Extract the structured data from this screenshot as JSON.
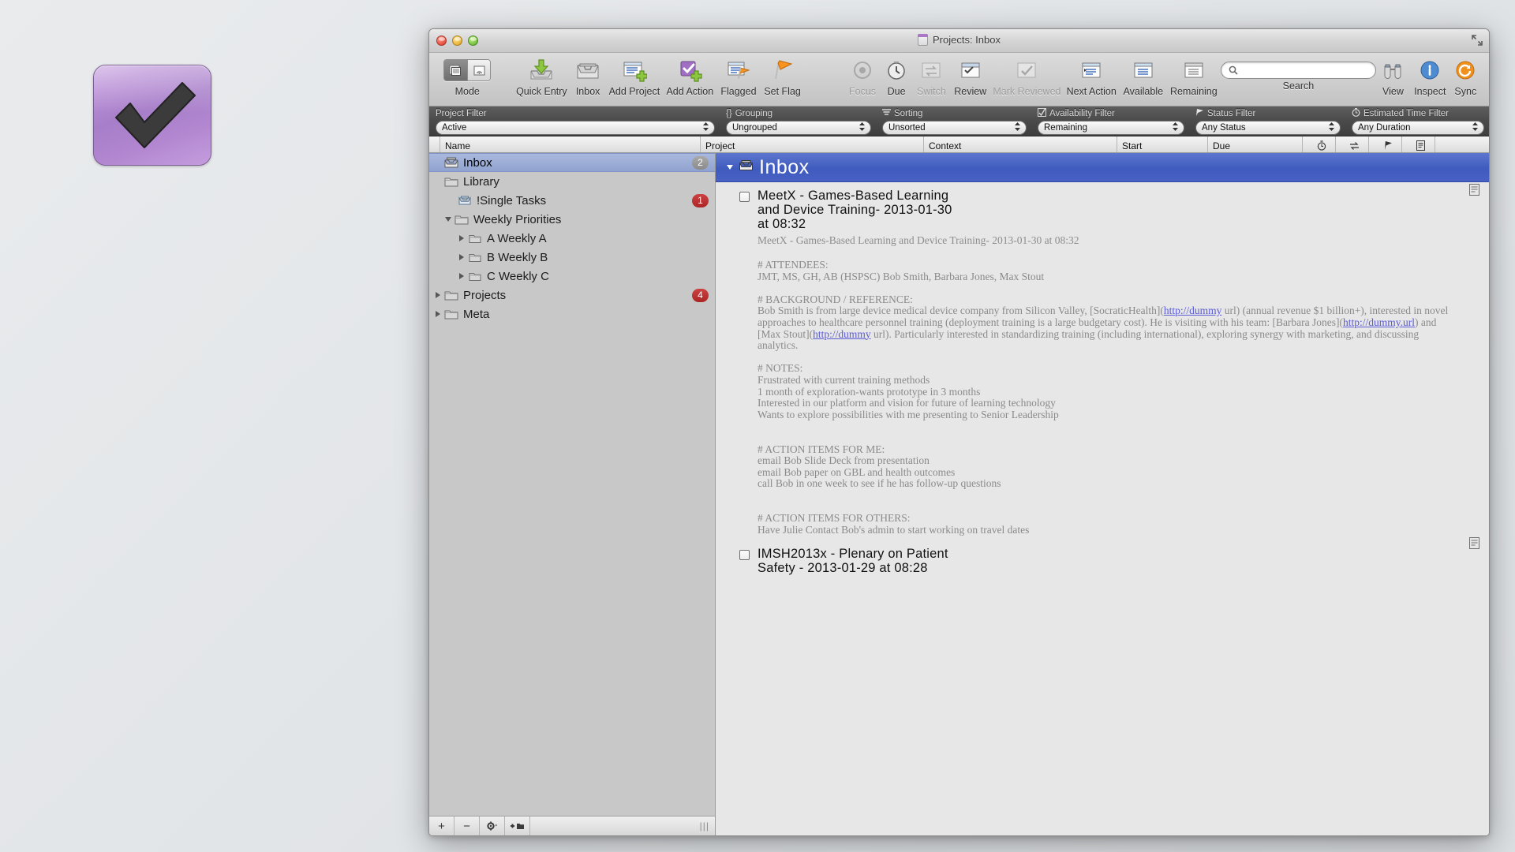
{
  "desktop": {
    "icon_name": "omnifocus-app-icon"
  },
  "window": {
    "title": "Projects: Inbox",
    "traffic_lights": [
      "close",
      "minimize",
      "zoom"
    ],
    "fullscreen_label": "full-screen"
  },
  "toolbar": {
    "items": [
      {
        "name": "mode",
        "label": "Mode",
        "icon": "segmented-mode-control",
        "disabled": false
      },
      {
        "name": "quick-entry",
        "label": "Quick Entry",
        "icon": "inbox-down-arrow-icon",
        "disabled": false
      },
      {
        "name": "inbox",
        "label": "Inbox",
        "icon": "inbox-tray-icon",
        "disabled": false
      },
      {
        "name": "add-project",
        "label": "Add Project",
        "icon": "list-plus-icon",
        "disabled": false
      },
      {
        "name": "add-action",
        "label": "Add Action",
        "icon": "purple-check-plus-icon",
        "disabled": false
      },
      {
        "name": "flagged",
        "label": "Flagged",
        "icon": "list-flag-icon",
        "disabled": false
      },
      {
        "name": "set-flag",
        "label": "Set Flag",
        "icon": "orange-flag-icon",
        "disabled": false
      },
      {
        "name": "focus",
        "label": "Focus",
        "icon": "focus-target-icon",
        "disabled": true
      },
      {
        "name": "due",
        "label": "Due",
        "icon": "clock-icon",
        "disabled": false
      },
      {
        "name": "switch",
        "label": "Switch",
        "icon": "switch-arrows-icon",
        "disabled": true
      },
      {
        "name": "review",
        "label": "Review",
        "icon": "review-calendar-icon",
        "disabled": false
      },
      {
        "name": "mark-reviewed",
        "label": "Mark Reviewed",
        "icon": "mark-reviewed-icon",
        "disabled": true
      },
      {
        "name": "next-action",
        "label": "Next Action",
        "icon": "next-action-icon",
        "disabled": false
      },
      {
        "name": "available",
        "label": "Available",
        "icon": "available-icon",
        "disabled": false
      },
      {
        "name": "remaining",
        "label": "Remaining",
        "icon": "remaining-icon",
        "disabled": false
      }
    ],
    "search": {
      "label": "Search",
      "placeholder": "",
      "value": ""
    },
    "right_items": [
      {
        "name": "view",
        "label": "View",
        "icon": "view-binoculars-icon"
      },
      {
        "name": "inspect",
        "label": "Inspect",
        "icon": "info-circle-icon"
      },
      {
        "name": "sync",
        "label": "Sync",
        "icon": "sync-refresh-icon"
      }
    ]
  },
  "filters": [
    {
      "name": "project-filter",
      "label": "Project Filter",
      "icon": "",
      "value": "Active"
    },
    {
      "name": "grouping",
      "label": "Grouping",
      "icon": "braces-icon",
      "value": "Ungrouped"
    },
    {
      "name": "sorting",
      "label": "Sorting",
      "icon": "sort-lines-icon",
      "value": "Unsorted"
    },
    {
      "name": "availability-filter",
      "label": "Availability Filter",
      "icon": "checkbox-icon",
      "value": "Remaining"
    },
    {
      "name": "status-filter",
      "label": "Status Filter",
      "icon": "flag-icon",
      "value": "Any Status"
    },
    {
      "name": "estimated-time-filter",
      "label": "Estimated Time Filter",
      "icon": "stopwatch-icon",
      "value": "Any Duration"
    }
  ],
  "columns": [
    {
      "name": "name",
      "label": "Name"
    },
    {
      "name": "project",
      "label": "Project"
    },
    {
      "name": "context",
      "label": "Context"
    },
    {
      "name": "start",
      "label": "Start"
    },
    {
      "name": "due",
      "label": "Due"
    }
  ],
  "column_icons": [
    {
      "name": "duration-column",
      "icon": "stopwatch-icon"
    },
    {
      "name": "repeat-column",
      "icon": "repeat-arrows-icon"
    },
    {
      "name": "flag-column",
      "icon": "flag-icon"
    },
    {
      "name": "note-column",
      "icon": "note-icon"
    }
  ],
  "sidebar": {
    "items": [
      {
        "name": "inbox",
        "label": "Inbox",
        "icon": "inbox-tray-icon",
        "indent": 0,
        "disclosure": "none",
        "badge": "2",
        "badge_color": "grey",
        "selected": true
      },
      {
        "name": "library",
        "label": "Library",
        "icon": "folder-icon",
        "indent": 0,
        "disclosure": "none",
        "badge": "",
        "badge_color": "",
        "selected": false
      },
      {
        "name": "single-tasks",
        "label": "!Single Tasks",
        "icon": "single-tasks-icon",
        "indent": 1,
        "disclosure": "none",
        "badge": "1",
        "badge_color": "red",
        "selected": false
      },
      {
        "name": "weekly-priorities",
        "label": "Weekly Priorities",
        "icon": "folder-icon",
        "indent": 1,
        "disclosure": "down",
        "badge": "",
        "badge_color": "",
        "selected": false
      },
      {
        "name": "a-weekly-a",
        "label": "A Weekly A",
        "icon": "folder-icon",
        "indent": 2,
        "disclosure": "right",
        "badge": "",
        "badge_color": "",
        "selected": false
      },
      {
        "name": "b-weekly-b",
        "label": "B Weekly B",
        "icon": "folder-icon",
        "indent": 2,
        "disclosure": "right",
        "badge": "",
        "badge_color": "",
        "selected": false
      },
      {
        "name": "c-weekly-c",
        "label": "C Weekly C",
        "icon": "folder-icon",
        "indent": 2,
        "disclosure": "right",
        "badge": "",
        "badge_color": "",
        "selected": false
      },
      {
        "name": "projects",
        "label": "Projects",
        "icon": "folder-icon",
        "indent": 1,
        "disclosure": "right",
        "badge": "4",
        "badge_color": "red",
        "selected": false
      },
      {
        "name": "meta",
        "label": "Meta",
        "icon": "folder-icon",
        "indent": 1,
        "disclosure": "right",
        "badge": "",
        "badge_color": "",
        "selected": false
      }
    ],
    "bottom_buttons": [
      {
        "name": "add-item-button",
        "label": "+",
        "icon": "plus-icon"
      },
      {
        "name": "remove-item-button",
        "label": "−",
        "icon": "minus-icon"
      },
      {
        "name": "action-menu-button",
        "label": "",
        "icon": "gear-icon"
      },
      {
        "name": "new-folder-button",
        "label": "",
        "icon": "new-folder-icon"
      }
    ]
  },
  "content": {
    "group": {
      "name": "inbox-group",
      "title": "Inbox",
      "icon": "inbox-tray-icon",
      "expanded": true
    },
    "tasks": [
      {
        "name": "task-meetx",
        "title_lines": [
          "MeetX - Games-Based Learning",
          "and Device Training- 2013-01-30",
          "at 08:32"
        ],
        "subtitle": "MeetX - Games-Based Learning and Device Training- 2013-01-30 at 08:32",
        "note": {
          "attendees_header": "# ATTENDEES:",
          "attendees": "JMT, MS, GH, AB (HSPSC)  Bob Smith, Barbara Jones, Max Stout",
          "background_header": "# BACKGROUND / REFERENCE:",
          "background_1a": "Bob Smith is from large device medical device company from Silicon Valley, [SocraticHealth](",
          "background_link1": "http://dummy",
          "background_1b": " url) (annual revenue $1 billion+), interested in novel",
          "background_2a": "approaches to healthcare personnel training (deployment training is a large budgetary cost). He is visiting with his team: [Barbara Jones](",
          "background_link2": "http://dummy.url",
          "background_2b": ") and [Max",
          "background_3a": "Stout](",
          "background_link3": "http://dummy",
          "background_3b": " url). Particularly interested in standardizing training (including international), exploring synergy with marketing, and discussing analytics.",
          "notes_header": "# NOTES:",
          "notes_lines": [
            "Frustrated with current training methods",
            "1 month of exploration-wants prototype in 3 months",
            "Interested in our platform and vision for future of learning technology",
            "Wants to explore possibilities with me presenting to Senior Leadership"
          ],
          "action_me_header": "# ACTION ITEMS FOR ME:",
          "action_me_lines": [
            "email Bob Slide Deck from presentation",
            "email Bob paper on GBL and health outcomes",
            "call Bob in one week to see if he has follow-up questions"
          ],
          "action_others_header": "# ACTION ITEMS FOR OTHERS:",
          "action_others_lines": [
            "Have Julie Contact Bob's admin to start working on travel dates"
          ]
        }
      },
      {
        "name": "task-imsh2013x",
        "title_lines": [
          "IMSH2013x - Plenary on Patient",
          "Safety - 2013-01-29 at 08:28"
        ],
        "subtitle": "",
        "note": null
      }
    ]
  },
  "colors": {
    "selection_blue": "#91a3d0",
    "group_header_blue": "#3f5bbd",
    "badge_red": "#ab2525",
    "badge_grey": "#8b8b8b",
    "link_blue": "#5b5bd6",
    "accent_purple": "#a77ec9"
  }
}
